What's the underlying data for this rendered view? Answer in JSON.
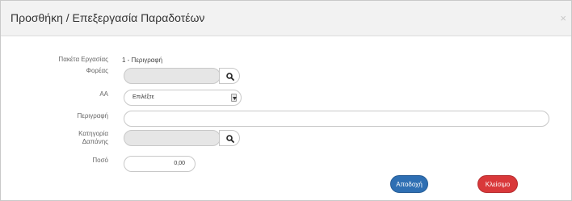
{
  "dialog": {
    "title": "Προσθήκη / Επεξεργασία Παραδοτέων",
    "close_glyph": "×"
  },
  "form": {
    "work_package": {
      "label": "Πακέτα Εργασίας",
      "value": "1 - Περιγραφή"
    },
    "agency": {
      "label": "Φορέας",
      "value": ""
    },
    "aa": {
      "label": "ΑΑ",
      "selected": "Επιλέξτε"
    },
    "description": {
      "label": "Περιγραφή",
      "value": ""
    },
    "expense_category": {
      "label_line1": "Κατηγορία",
      "label_line2": "Δαπάνης",
      "value": ""
    },
    "amount": {
      "label": "Ποσό",
      "value": "0,00"
    }
  },
  "buttons": {
    "accept": "Αποδοχή",
    "close": "Κλείσιμο"
  },
  "colors": {
    "accept": "#2e6fb3",
    "close": "#d9383a",
    "header_bg": "#f2f2f2",
    "disabled_field": "#e6e6e6"
  },
  "icons": {
    "search": "search-icon",
    "dropdown": "chevron-down-icon",
    "close": "close-icon"
  }
}
